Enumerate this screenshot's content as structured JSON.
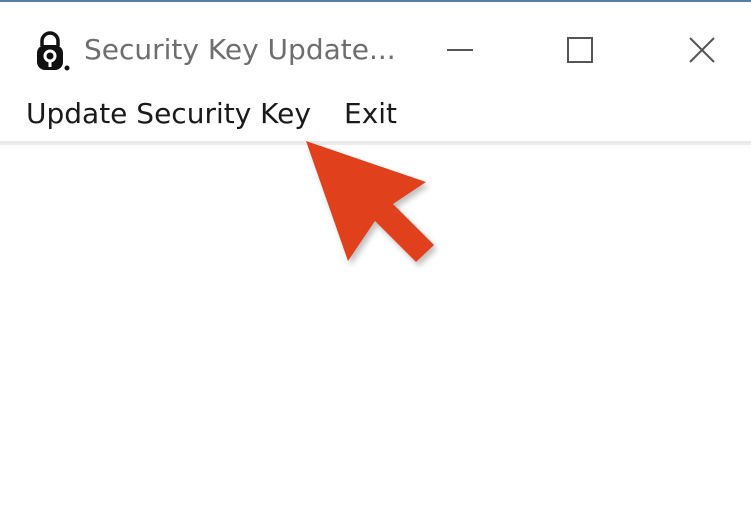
{
  "window": {
    "title": "Security Key Update...",
    "controls": {
      "minimize_icon": "minimize-icon",
      "maximize_icon": "maximize-icon",
      "close_icon": "close-icon"
    }
  },
  "menu": {
    "items": [
      {
        "label": "Update Security Key"
      },
      {
        "label": "Exit"
      }
    ]
  },
  "annotation": {
    "arrow_color": "#e0401e",
    "icon": "arrow-pointer-icon"
  },
  "colors": {
    "title_text": "#6e6e6e",
    "menu_text": "#1a1a1a",
    "window_border": "#5a7da8",
    "menu_divider": "#ebebeb"
  }
}
